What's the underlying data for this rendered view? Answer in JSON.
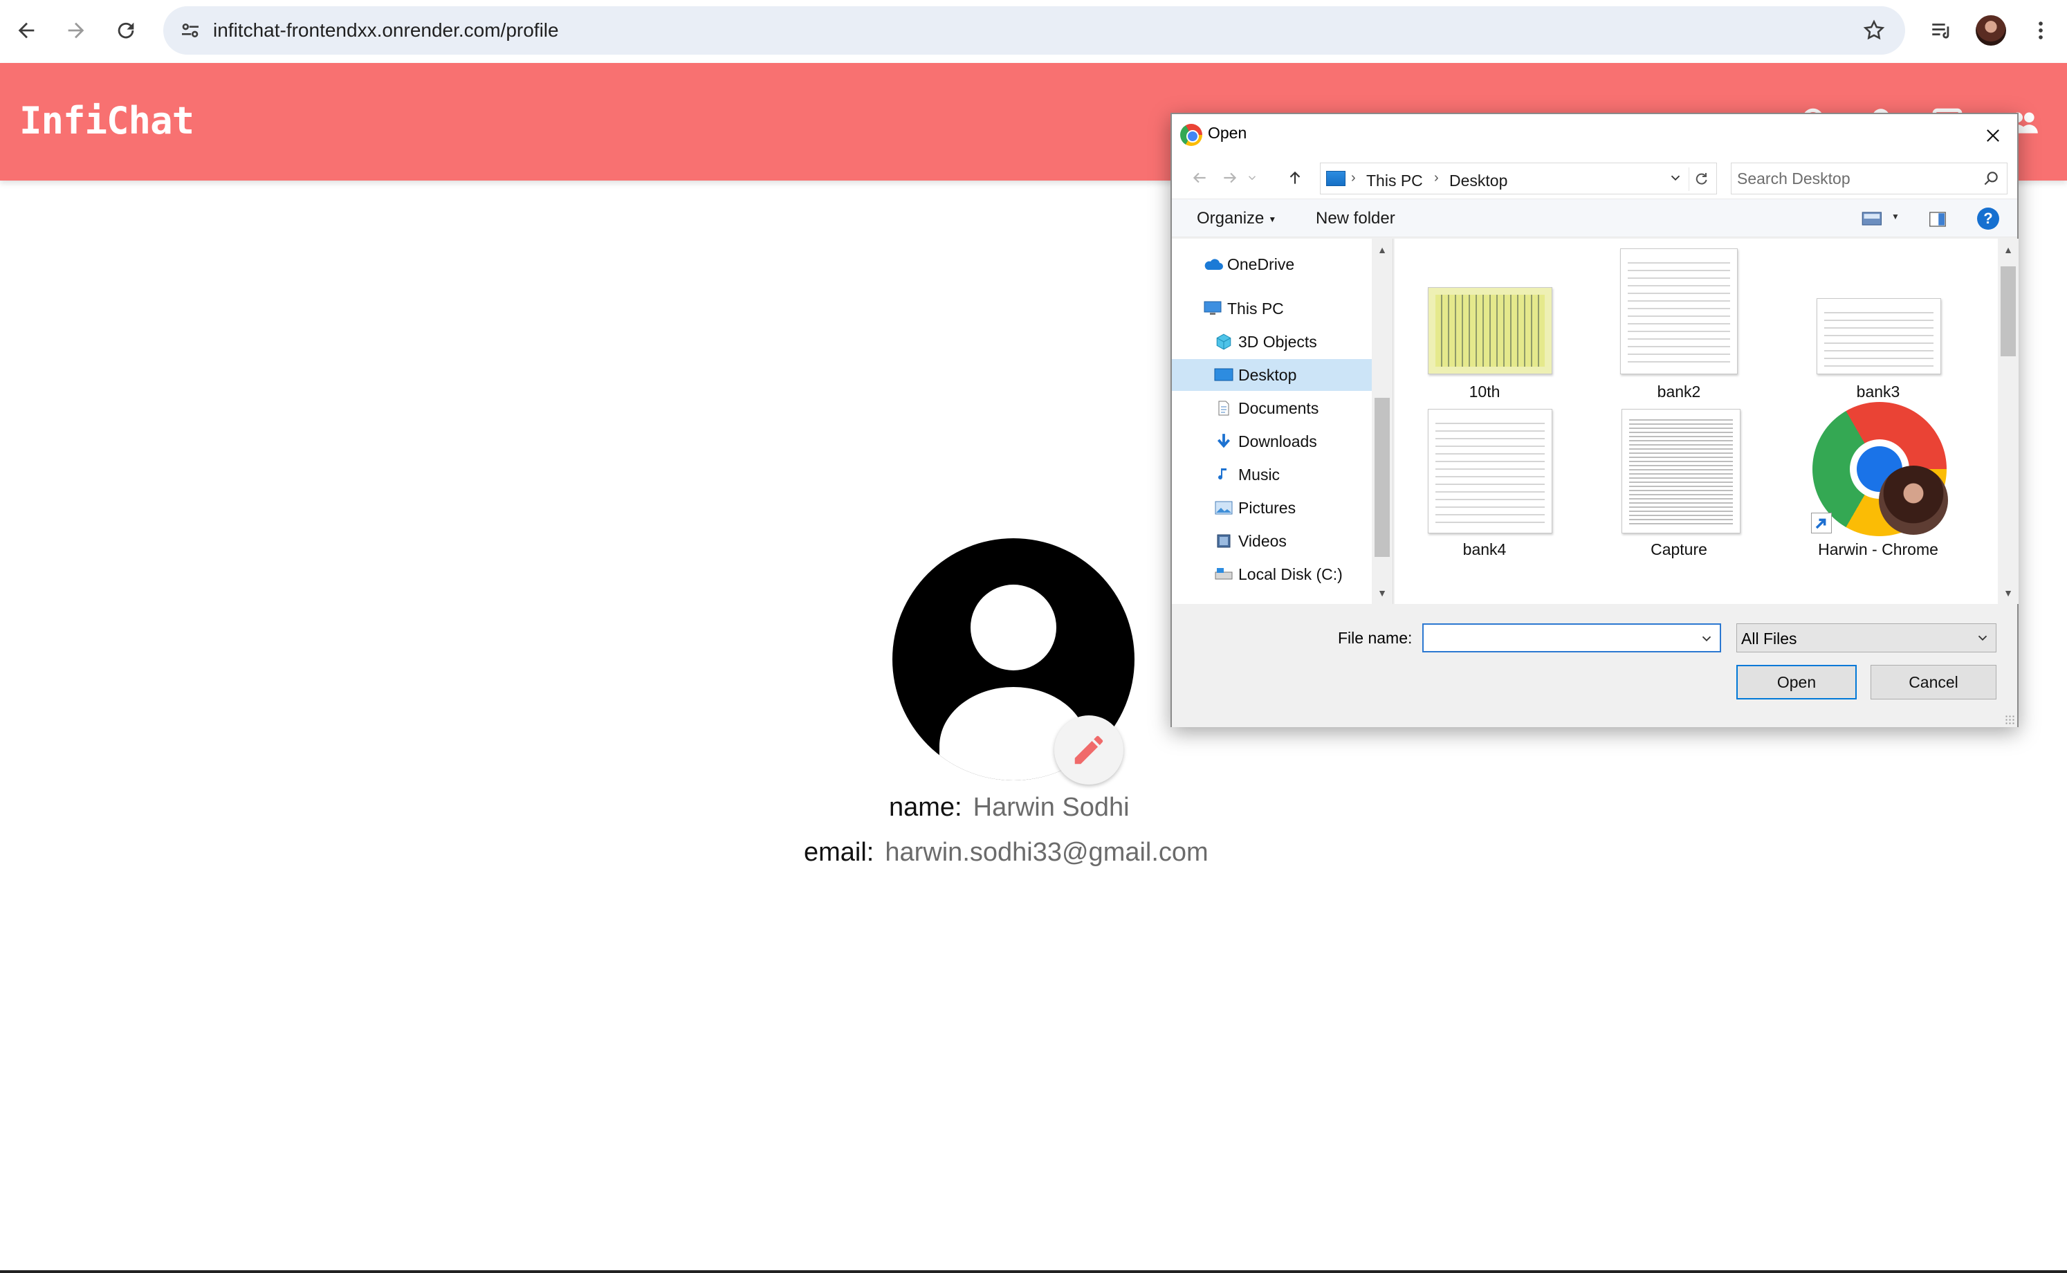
{
  "browser": {
    "url": "infitchat-frontendxx.onrender.com/profile"
  },
  "app": {
    "logo": "InfiChat",
    "accent_color": "#f87171"
  },
  "profile": {
    "name_label": "name:",
    "name_value": "Harwin Sodhi",
    "email_label": "email:",
    "email_value": "harwin.sodhi33@gmail.com"
  },
  "dialog": {
    "title": "Open",
    "breadcrumb": [
      "This PC",
      "Desktop"
    ],
    "search_placeholder": "Search Desktop",
    "commands": {
      "organize": "Organize",
      "new_folder": "New folder"
    },
    "nav_items": [
      {
        "label": "OneDrive",
        "icon": "cloud-icon"
      },
      {
        "label": "This PC",
        "icon": "computer-icon"
      },
      {
        "label": "3D Objects",
        "icon": "cube-icon"
      },
      {
        "label": "Desktop",
        "icon": "desktop-icon",
        "selected": true
      },
      {
        "label": "Documents",
        "icon": "document-icon"
      },
      {
        "label": "Downloads",
        "icon": "download-icon"
      },
      {
        "label": "Music",
        "icon": "music-icon"
      },
      {
        "label": "Pictures",
        "icon": "pictures-icon"
      },
      {
        "label": "Videos",
        "icon": "videos-icon"
      },
      {
        "label": "Local Disk (C:)",
        "icon": "drive-icon"
      }
    ],
    "files": [
      {
        "label": "10th"
      },
      {
        "label": "bank2"
      },
      {
        "label": "bank3"
      },
      {
        "label": "bank4"
      },
      {
        "label": "Capture"
      },
      {
        "label": "Harwin - Chrome"
      }
    ],
    "filename_label": "File name:",
    "filename_value": "",
    "filter_value": "All Files",
    "open_label": "Open",
    "cancel_label": "Cancel"
  }
}
